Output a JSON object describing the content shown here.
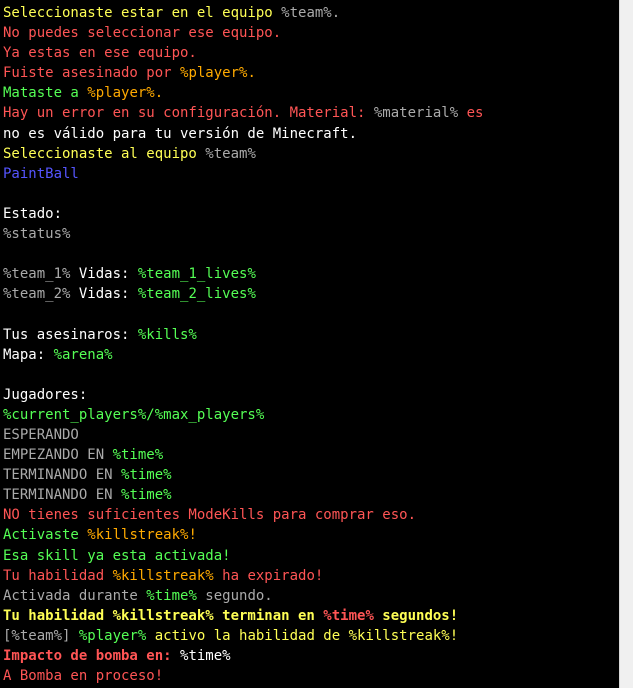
{
  "colors": {
    "yellow": "#ffff55",
    "red": "#ff5555",
    "gray": "#aaaaaa",
    "gold": "#ffaa00",
    "green": "#55ff55",
    "white": "#ffffff",
    "blue": "#5555ff"
  },
  "lines": [
    [
      {
        "t": "Seleccionaste estar en el equipo ",
        "c": "yellow"
      },
      {
        "t": "%team%.",
        "c": "gray"
      }
    ],
    [
      {
        "t": "No puedes seleccionar ese equipo.",
        "c": "red"
      }
    ],
    [
      {
        "t": "Ya estas en ese equipo.",
        "c": "red"
      }
    ],
    [
      {
        "t": "Fuiste asesinado por ",
        "c": "red"
      },
      {
        "t": "%player%.",
        "c": "gold"
      }
    ],
    [
      {
        "t": "Mataste a ",
        "c": "green"
      },
      {
        "t": "%player%.",
        "c": "gold"
      }
    ],
    [
      {
        "t": "Hay un error en su configuración. Material: ",
        "c": "red"
      },
      {
        "t": "%material%",
        "c": "gray"
      },
      {
        "t": " es",
        "c": "red"
      }
    ],
    [
      {
        "t": "no es válido para tu versión de Minecraft.",
        "c": "white"
      }
    ],
    [
      {
        "t": "Seleccionaste al equipo ",
        "c": "yellow"
      },
      {
        "t": "%team%",
        "c": "gray"
      }
    ],
    [
      {
        "t": "PaintBall",
        "c": "blue"
      }
    ],
    [],
    [
      {
        "t": "Estado:",
        "c": "white"
      }
    ],
    [
      {
        "t": "%status%",
        "c": "gray"
      }
    ],
    [],
    [
      {
        "t": "%team_1%",
        "c": "gray"
      },
      {
        "t": " Vidas: ",
        "c": "white"
      },
      {
        "t": "%team_1_lives%",
        "c": "green"
      }
    ],
    [
      {
        "t": "%team_2%",
        "c": "gray"
      },
      {
        "t": " Vidas: ",
        "c": "white"
      },
      {
        "t": "%team_2_lives%",
        "c": "green"
      }
    ],
    [],
    [
      {
        "t": "Tus asesinaros: ",
        "c": "white"
      },
      {
        "t": "%kills%",
        "c": "green"
      }
    ],
    [
      {
        "t": "Mapa: ",
        "c": "white"
      },
      {
        "t": "%arena%",
        "c": "green"
      }
    ],
    [],
    [
      {
        "t": "Jugadores:",
        "c": "white"
      }
    ],
    [
      {
        "t": "%current_players%/%max_players%",
        "c": "green"
      }
    ],
    [
      {
        "t": "ESPERANDO",
        "c": "gray"
      }
    ],
    [
      {
        "t": "EMPEZANDO EN ",
        "c": "gray"
      },
      {
        "t": "%time%",
        "c": "green"
      }
    ],
    [
      {
        "t": "TERMINANDO EN ",
        "c": "gray"
      },
      {
        "t": "%time%",
        "c": "green"
      }
    ],
    [
      {
        "t": "TERMINANDO EN ",
        "c": "gray"
      },
      {
        "t": "%time%",
        "c": "green"
      }
    ],
    [
      {
        "t": "NO tienes suficientes ModeKills para comprar eso.",
        "c": "red"
      }
    ],
    [
      {
        "t": "Activaste ",
        "c": "green"
      },
      {
        "t": "%killstreak%!",
        "c": "gold"
      }
    ],
    [
      {
        "t": "Esa skill ya esta activada!",
        "c": "green"
      }
    ],
    [
      {
        "t": "Tu habilidad ",
        "c": "red"
      },
      {
        "t": "%killstreak%",
        "c": "gold"
      },
      {
        "t": " ha expirado!",
        "c": "red"
      }
    ],
    [
      {
        "t": "Activada durante ",
        "c": "gray"
      },
      {
        "t": "%time%",
        "c": "green"
      },
      {
        "t": " segundo.",
        "c": "gray"
      }
    ],
    [
      {
        "t": "Tu habilidad %killstreak% terminan en ",
        "c": "yellow",
        "b": true
      },
      {
        "t": "%time%",
        "c": "red",
        "b": true
      },
      {
        "t": " segundos!",
        "c": "yellow",
        "b": true
      }
    ],
    [
      {
        "t": "[%team%]",
        "c": "gray"
      },
      {
        "t": " %player%",
        "c": "green"
      },
      {
        "t": " activo la habilidad de %killstreak%!",
        "c": "yellow"
      }
    ],
    [
      {
        "t": "Impacto de bomba en: ",
        "c": "red",
        "b": true
      },
      {
        "t": "%time%",
        "c": "white"
      }
    ],
    [
      {
        "t": "A Bomba en proceso!",
        "c": "red"
      }
    ]
  ]
}
